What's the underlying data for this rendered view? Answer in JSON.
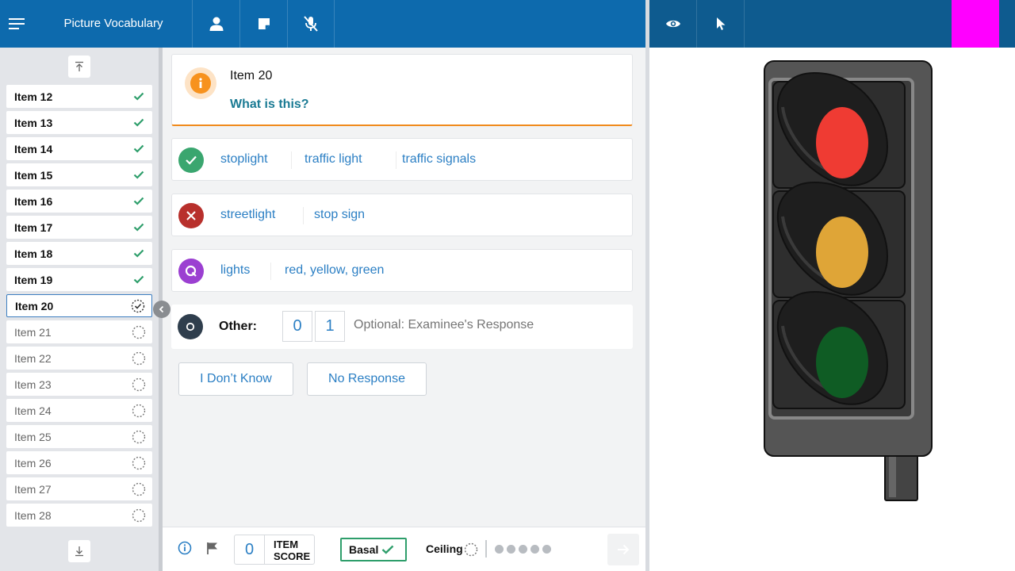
{
  "app": {
    "title": "Picture Vocabulary",
    "icons": [
      "menu-icon",
      "user-icon",
      "note-icon",
      "mic-off-icon",
      "eye-icon",
      "pointer-icon"
    ],
    "colors": {
      "topbar": "#0d6aad",
      "right_topbar": "#0e5b8f",
      "magenta_block": "#ff00ff"
    }
  },
  "sidebar": {
    "items": [
      {
        "label": "Item 12",
        "status": "done"
      },
      {
        "label": "Item 13",
        "status": "done"
      },
      {
        "label": "Item 14",
        "status": "done"
      },
      {
        "label": "Item 15",
        "status": "done"
      },
      {
        "label": "Item 16",
        "status": "done"
      },
      {
        "label": "Item 17",
        "status": "done"
      },
      {
        "label": "Item 18",
        "status": "done"
      },
      {
        "label": "Item 19",
        "status": "done"
      },
      {
        "label": "Item 20",
        "status": "current"
      },
      {
        "label": "Item 21",
        "status": "pending"
      },
      {
        "label": "Item 22",
        "status": "pending"
      },
      {
        "label": "Item 23",
        "status": "pending"
      },
      {
        "label": "Item 24",
        "status": "pending"
      },
      {
        "label": "Item 25",
        "status": "pending"
      },
      {
        "label": "Item 26",
        "status": "pending"
      },
      {
        "label": "Item 27",
        "status": "pending"
      },
      {
        "label": "Item 28",
        "status": "pending"
      }
    ]
  },
  "item": {
    "title": "Item 20",
    "question": "What is this?"
  },
  "responses": {
    "correct": [
      "stoplight",
      "traffic light",
      "traffic signals"
    ],
    "incorrect": [
      "streetlight",
      "stop sign"
    ],
    "query": [
      "lights",
      "red, yellow, green"
    ]
  },
  "other": {
    "label": "Other:",
    "score_options": [
      "0",
      "1"
    ],
    "placeholder": "Optional: Examinee's Response"
  },
  "actions": {
    "dont_know": "I Don’t Know",
    "no_response": "No Response"
  },
  "footer": {
    "item_score_value": "0",
    "item_score_label_line1": "ITEM",
    "item_score_label_line2": "SCORE",
    "basal_label": "Basal",
    "ceiling_label": "Ceiling",
    "ceiling_dots_count": 5
  }
}
